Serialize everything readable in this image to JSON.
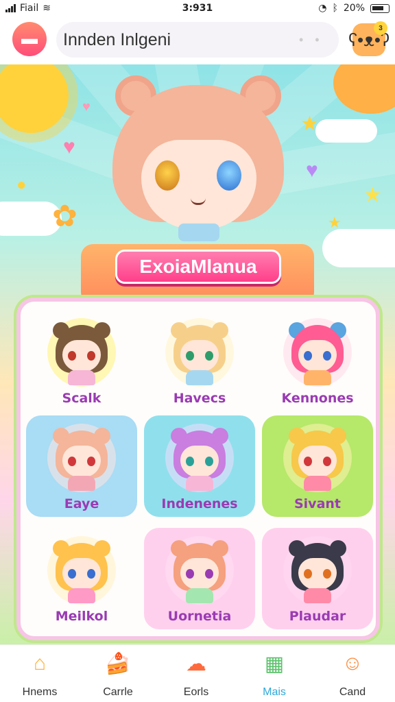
{
  "status": {
    "carrier": "Fiail",
    "time": "3:931",
    "battery": "20%"
  },
  "header": {
    "search_value": "Innden Inlgeni",
    "profile_badge": "3"
  },
  "banner": {
    "title": "ExoiaMlanua"
  },
  "grid": [
    {
      "name": "Scalk",
      "hair": "#7b5a3c",
      "ear": "#7b5a3c",
      "halo": "#fff27a",
      "bg": "transparent",
      "eye": "#c0392b",
      "body": "#f7b6d6"
    },
    {
      "name": "Havecs",
      "hair": "#f6d08a",
      "ear": "#f6d08a",
      "halo": "#fff4c8",
      "bg": "transparent",
      "eye": "#2e9d6b",
      "body": "#a6d7f0"
    },
    {
      "name": "Kennones",
      "hair": "#ff5c93",
      "ear": "#5aa4e0",
      "halo": "#ffd9e8",
      "bg": "transparent",
      "eye": "#3a6ed0",
      "body": "#ffb46a"
    },
    {
      "name": "Eaye",
      "hair": "#f4b59a",
      "ear": "#f4b59a",
      "halo": "#ffe6e0",
      "bg": "#a9dcf5",
      "eye": "#d0383c",
      "body": "#f3a7b5"
    },
    {
      "name": "Indenenes",
      "hair": "#c97ee0",
      "ear": "#c97ee0",
      "halo": "#f2dcff",
      "bg": "#8fe0ec",
      "eye": "#2aa198",
      "body": "#f7b6d6"
    },
    {
      "name": "Sivant",
      "hair": "#f7c84a",
      "ear": "#f7c84a",
      "halo": "#fff2b0",
      "bg": "#b6e86a",
      "eye": "#d0383c",
      "body": "#ff8aa8"
    },
    {
      "name": "Meilkol",
      "hair": "#ffc24d",
      "ear": "#ffc24d",
      "halo": "#fff1c2",
      "bg": "transparent",
      "eye": "#3a6ed0",
      "body": "#ff99c6"
    },
    {
      "name": "Uornetia",
      "hair": "#f5a07e",
      "ear": "#f5a07e",
      "halo": "#ffe0f1",
      "bg": "#ffd0ee",
      "eye": "#9a3bb3",
      "body": "#a3e6b0"
    },
    {
      "name": "Plaudar",
      "hair": "#3a3a4a",
      "ear": "#3a3a4a",
      "halo": "#ffd9f2",
      "bg": "#ffd0ee",
      "eye": "#e07020",
      "body": "#ff8aa8"
    }
  ],
  "tabs": [
    {
      "label": "Hnems",
      "icon": "home-icon",
      "glyph": "⌂",
      "color": "#ffb23c",
      "active": false
    },
    {
      "label": "Carrle",
      "icon": "cake-icon",
      "glyph": "🍰",
      "color": "#ff7fb0",
      "active": false
    },
    {
      "label": "Eorls",
      "icon": "cloud-icon",
      "glyph": "☁",
      "color": "#ff6a3c",
      "active": false
    },
    {
      "label": "Mais",
      "icon": "map-icon",
      "glyph": "▦",
      "color": "#5bc26b",
      "active": true
    },
    {
      "label": "Cand",
      "icon": "character-icon",
      "glyph": "☺",
      "color": "#ff8a3c",
      "active": false
    }
  ]
}
